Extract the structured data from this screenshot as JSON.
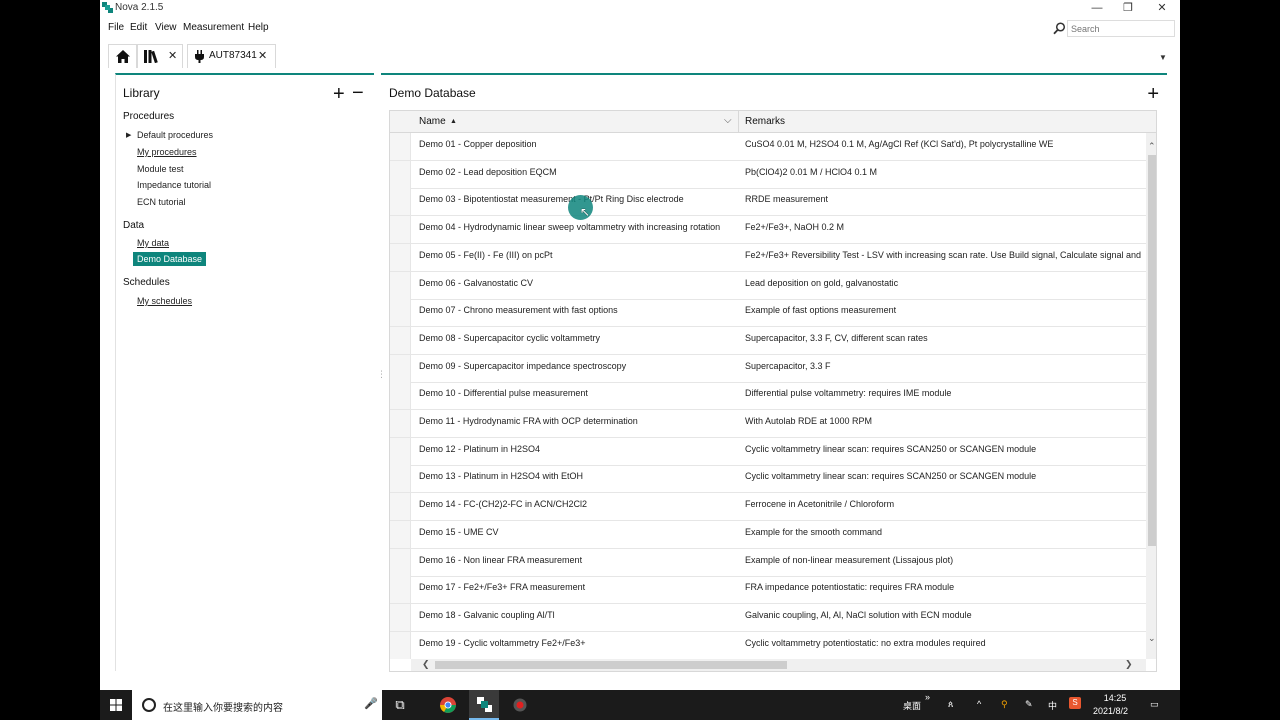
{
  "window": {
    "title": "Nova 2.1.5",
    "minimize": "—",
    "restore": "❐",
    "close": "✕"
  },
  "menu": [
    "File",
    "Edit",
    "View",
    "Measurement",
    "Help"
  ],
  "search": {
    "placeholder": "Search"
  },
  "tabs": {
    "home_icon": "home-icon",
    "library_icon": "library-icon",
    "close_glyph": "✕",
    "instrument_label": "AUT87341",
    "instrument_icon": "plug-icon",
    "tab_menu_glyph": "▼"
  },
  "library": {
    "title": "Library",
    "add_glyph": "+",
    "remove_glyph": "−",
    "sections": {
      "procedures": {
        "title": "Procedures",
        "items": [
          "Default procedures",
          "My procedures",
          "Module test",
          "Impedance tutorial",
          "ECN tutorial"
        ]
      },
      "data": {
        "title": "Data",
        "items": [
          "My data",
          "Demo Database"
        ]
      },
      "schedules": {
        "title": "Schedules",
        "items": [
          "My schedules"
        ]
      }
    },
    "selected_item": "Demo Database"
  },
  "database": {
    "title": "Demo Database",
    "add_glyph": "+",
    "columns": [
      "Name",
      "Remarks"
    ],
    "sort_glyph": "▲",
    "filter_glyph": "⌵",
    "rows": [
      {
        "name": "Demo 01 - Copper deposition",
        "remark": "CuSO4 0.01 M, H2SO4 0.1 M, Ag/AgCl Ref (KCl Sat'd), Pt polycrystalline WE"
      },
      {
        "name": "Demo 02 - Lead deposition EQCM",
        "remark": "Pb(ClO4)2 0.01 M / HClO4 0.1 M"
      },
      {
        "name": "Demo 03 - Bipotentiostat measurement - Pt/Pt Ring Disc electrode",
        "remark": "RRDE measurement"
      },
      {
        "name": "Demo 04 - Hydrodynamic linear sweep voltammetry with increasing rotation",
        "remark": "Fe2+/Fe3+, NaOH 0.2 M"
      },
      {
        "name": "Demo 05 - Fe(II) - Fe (III) on pcPt",
        "remark": "Fe2+/Fe3+ Reversibility Test - LSV with increasing scan rate. Use Build signal,  Calculate signal and"
      },
      {
        "name": "Demo 06 - Galvanostatic CV",
        "remark": "Lead deposition on gold, galvanostatic"
      },
      {
        "name": "Demo 07 - Chrono measurement with fast options",
        "remark": "Example of fast options measurement"
      },
      {
        "name": "Demo 08 - Supercapacitor cyclic voltammetry",
        "remark": "Supercapacitor, 3.3 F, CV, different scan rates"
      },
      {
        "name": "Demo 09 - Supercapacitor impedance spectroscopy",
        "remark": "Supercapacitor, 3.3 F"
      },
      {
        "name": "Demo 10 - Differential pulse measurement",
        "remark": "Differential pulse voltammetry: requires IME module"
      },
      {
        "name": "Demo 11 - Hydrodynamic FRA with OCP determination",
        "remark": "With Autolab RDE at 1000 RPM"
      },
      {
        "name": "Demo 12 - Platinum in H2SO4",
        "remark": "Cyclic voltammetry linear scan: requires SCAN250 or SCANGEN module"
      },
      {
        "name": "Demo 13 - Platinum in H2SO4 with EtOH",
        "remark": "Cyclic voltammetry linear scan: requires SCAN250 or SCANGEN module"
      },
      {
        "name": "Demo 14 - FC-(CH2)2-FC in ACN/CH2Cl2",
        "remark": "Ferrocene in Acetonitrile / Chloroform"
      },
      {
        "name": "Demo 15 - UME CV",
        "remark": "Example for the smooth command"
      },
      {
        "name": "Demo 16 - Non linear FRA measurement",
        "remark": "Example of non-linear measurement (Lissajous plot)"
      },
      {
        "name": "Demo 17 - Fe2+/Fe3+ FRA measurement",
        "remark": "FRA impedance potentiostatic: requires FRA module"
      },
      {
        "name": "Demo 18 - Galvanic coupling Al/Tl",
        "remark": "Galvanic coupling, Al, Al, NaCl solution with ECN module"
      },
      {
        "name": "Demo 19 - Cyclic voltammetry Fe2+/Fe3+",
        "remark": "Cyclic voltammetry potentiostatic: no extra modules required"
      }
    ],
    "scroll": {
      "up": "⌃",
      "down": "⌄",
      "left": "❮",
      "right": "❯"
    }
  },
  "taskbar": {
    "start_icon": "windows-icon",
    "search_placeholder": "在这里输入你要搜索的内容",
    "mic_glyph": "🎤",
    "task_view_glyph": "⧉",
    "apps": [
      "chrome-icon",
      "nova-icon",
      "recorder-icon"
    ],
    "tray": {
      "desktop_label": "桌面",
      "overflow": "»",
      "person": "ጰ",
      "up_arrow": "^",
      "pen": "✎",
      "ime": "中",
      "time": "14:25",
      "date": "2021/8/2",
      "notification": "🗨"
    }
  },
  "colors": {
    "accent": "#0e857c",
    "taskbar": "#1b1b1b"
  }
}
